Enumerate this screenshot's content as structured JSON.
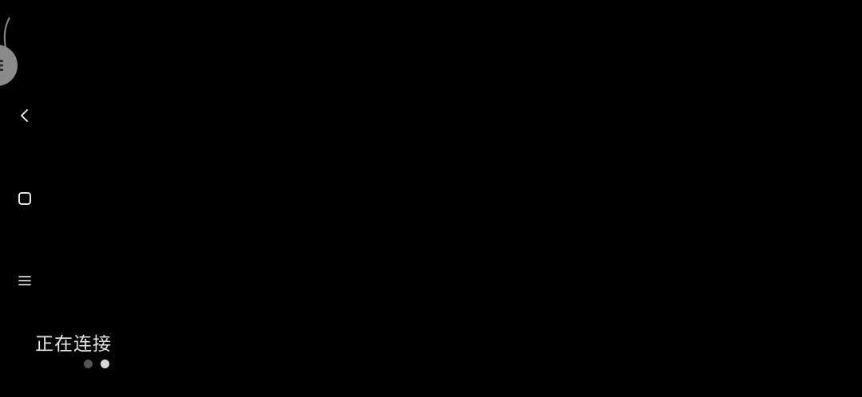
{
  "screen": {
    "background_color": "#000000"
  },
  "floating_ball": {
    "icon": "menu-lines-icon",
    "color": "#8a8a8a"
  },
  "navigation": {
    "back_icon": "chevron-left-icon",
    "home_icon": "square-outline-icon",
    "recents_icon": "menu-lines-icon",
    "icon_color": "#ffffff"
  },
  "status": {
    "text": "正在连接"
  },
  "pager": {
    "page_count": 2,
    "active_page": 2,
    "active_color": "#d9d9d9",
    "inactive_color": "#555555"
  }
}
